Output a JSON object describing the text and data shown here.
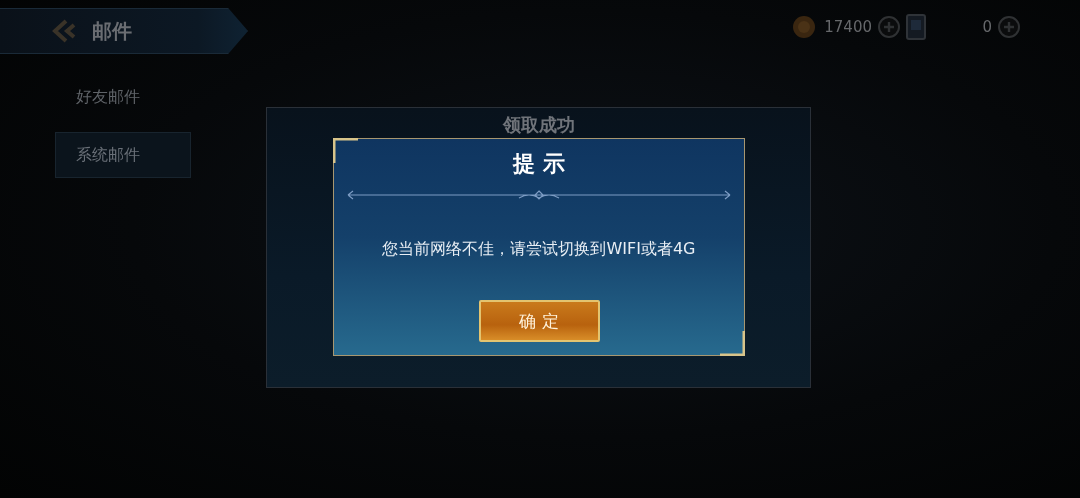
{
  "header": {
    "title": "邮件"
  },
  "currencies": [
    {
      "kind": "coin",
      "amount": "17400"
    },
    {
      "kind": "card",
      "amount": "0"
    }
  ],
  "sidebar": {
    "items": [
      {
        "label": "好友邮件",
        "selected": false
      },
      {
        "label": "系统邮件",
        "selected": true
      }
    ]
  },
  "background_dialog": {
    "title": "领取成功"
  },
  "dialog": {
    "title": "提 示",
    "message": "您当前网络不佳，请尝试切换到WIFI或者4G",
    "button": "确 定"
  }
}
